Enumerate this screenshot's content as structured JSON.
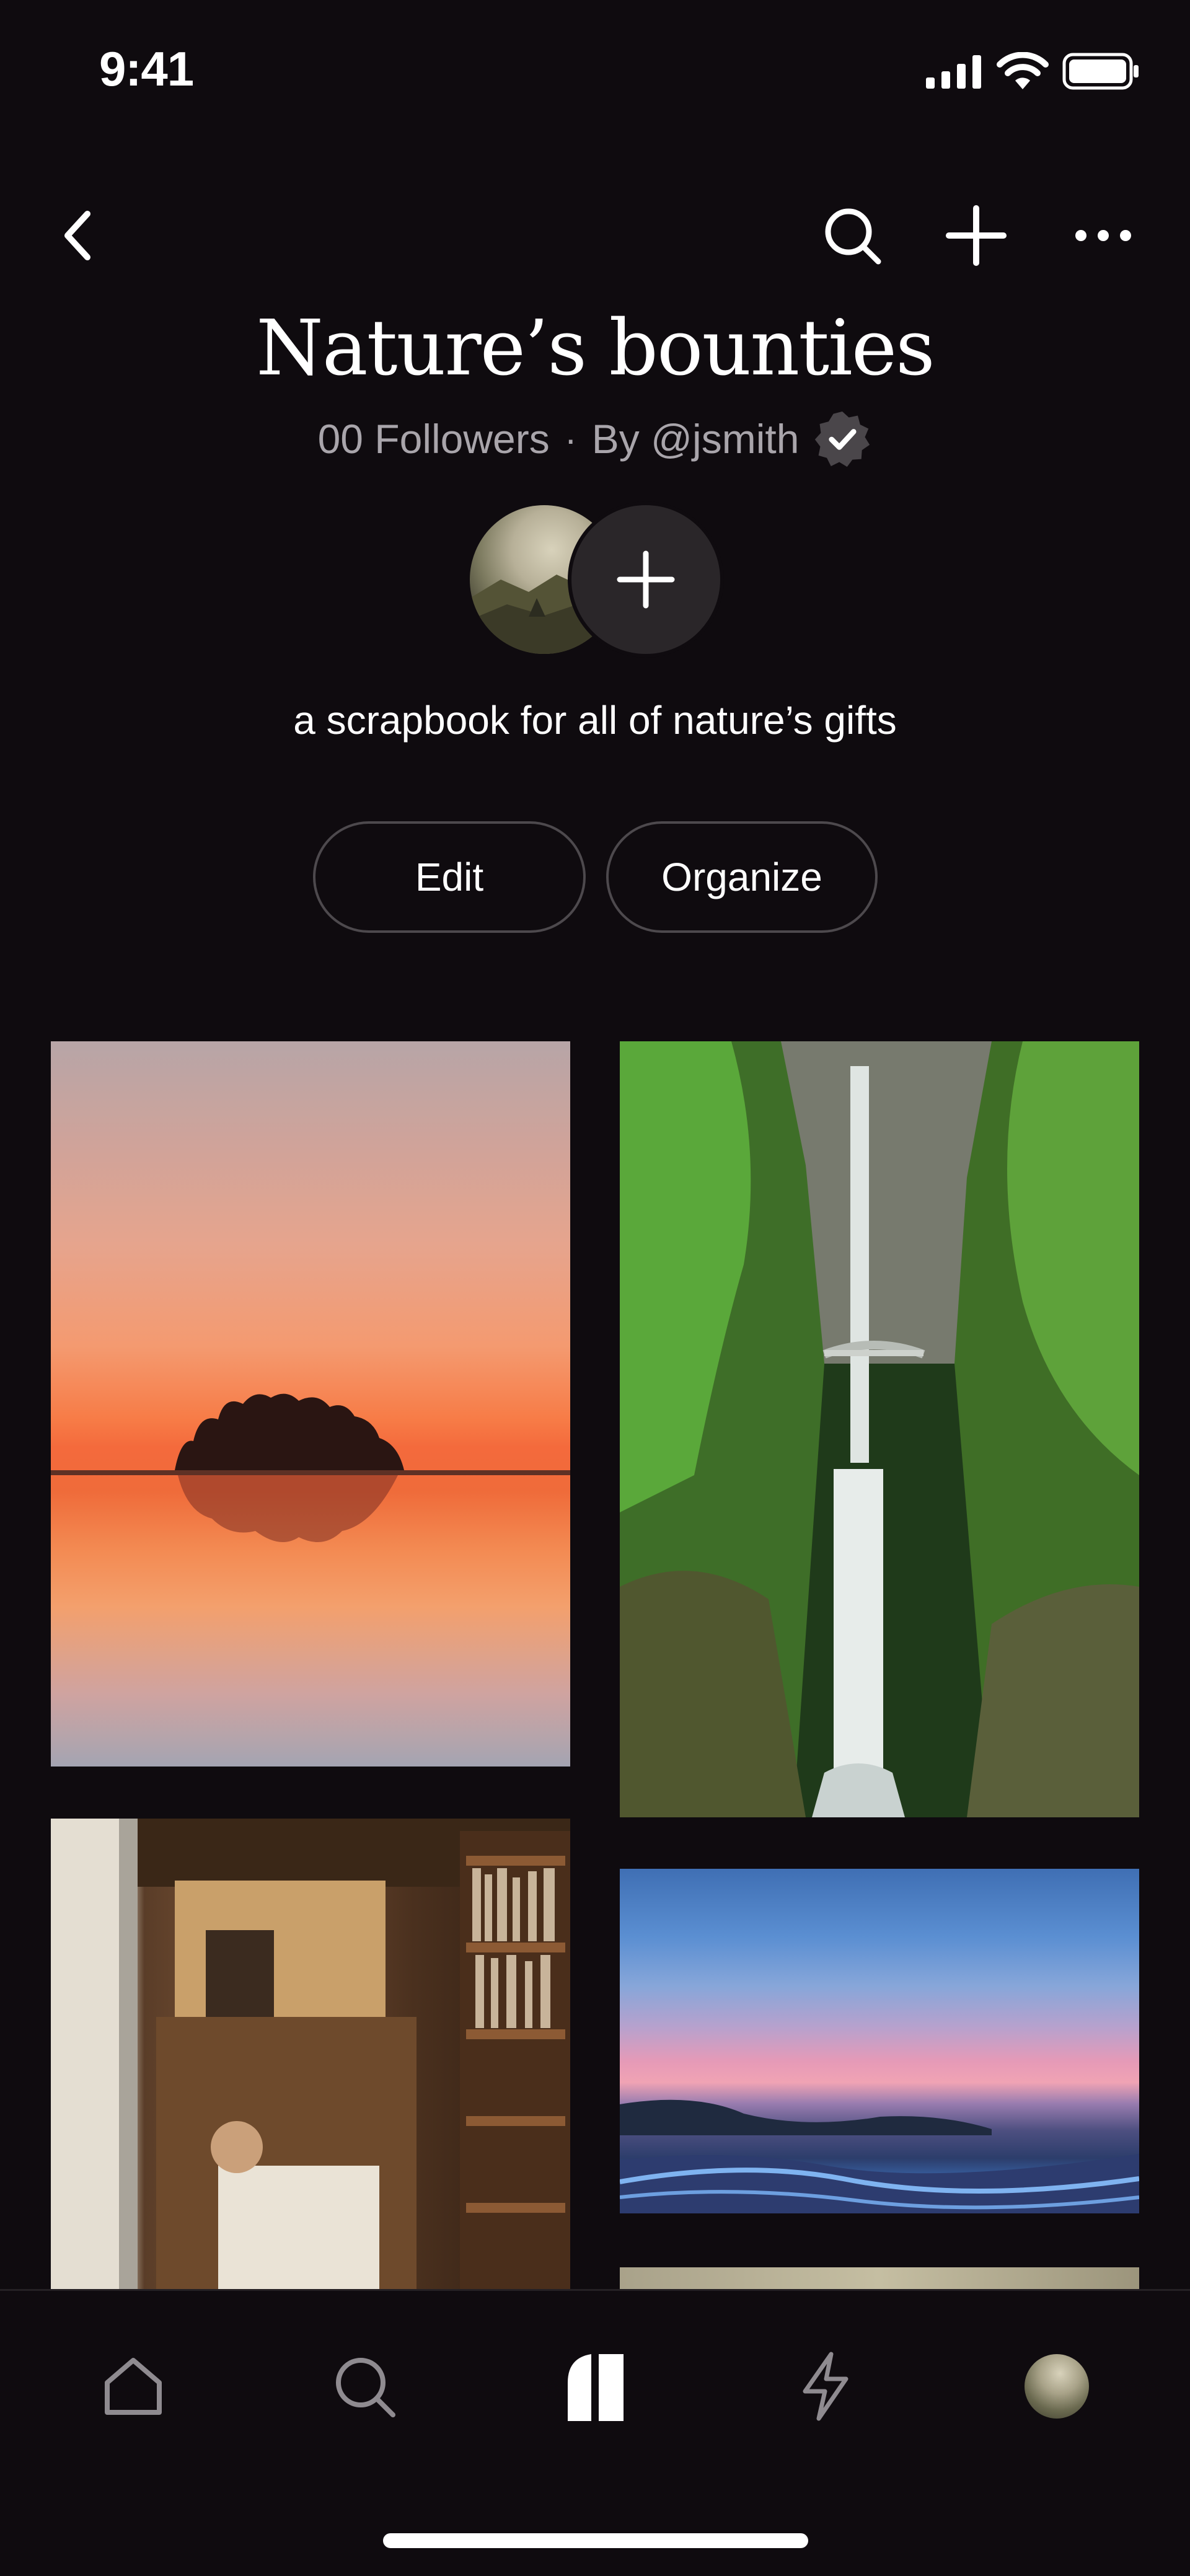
{
  "status_bar": {
    "time": "9:41",
    "icons": [
      "cellular-signal-icon",
      "wifi-icon",
      "battery-icon"
    ]
  },
  "header": {
    "back_icon": "chevron-left-icon",
    "actions": [
      "search-icon",
      "plus-icon",
      "more-horizontal-icon"
    ]
  },
  "board": {
    "title": "Nature’s bounties",
    "followers": "00 Followers",
    "separator": "·",
    "by_label": "By @jsmith",
    "verified_icon": "verified-badge-icon",
    "description": "a scrapbook for all of nature’s gifts"
  },
  "collaborators": {
    "add_icon": "plus-icon"
  },
  "actions": {
    "edit_label": "Edit",
    "organize_label": "Organize"
  },
  "pins": [
    {
      "subject": "sunset-over-lake-island"
    },
    {
      "subject": "waterfall-with-bridge"
    },
    {
      "subject": "bookshop-interior"
    },
    {
      "subject": "beach-sunset"
    },
    {
      "subject": "partial-image"
    }
  ],
  "tabbar": {
    "tabs": [
      "home-icon",
      "search-icon",
      "boards-icon",
      "activity-bolt-icon",
      "profile-avatar"
    ],
    "active": "boards-icon"
  },
  "colors": {
    "background": "#0f0b0f",
    "pill_border": "#4d494d",
    "muted_text": "#a9a5ab",
    "add_circle": "#2a2629"
  }
}
